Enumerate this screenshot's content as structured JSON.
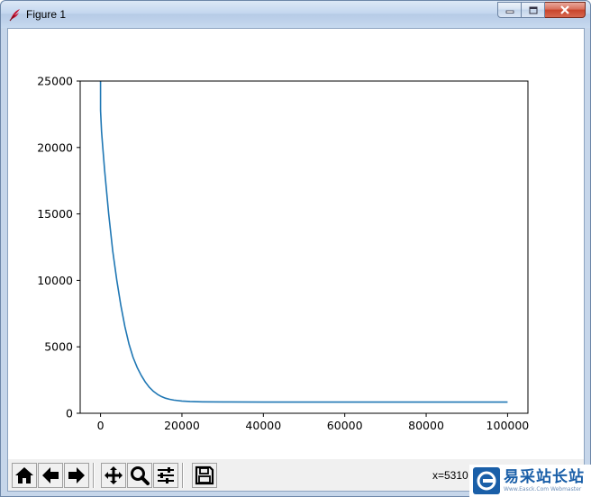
{
  "window": {
    "title": "Figure 1",
    "icon": "tk-feather-icon"
  },
  "caption_buttons": {
    "minimize": "minimize-icon",
    "maximize": "maximize-icon",
    "close": "close-icon"
  },
  "chart_data": {
    "type": "line",
    "title": "",
    "xlabel": "",
    "ylabel": "",
    "xlim": [
      -5000,
      105000
    ],
    "ylim": [
      0,
      25000
    ],
    "x_ticks": [
      0,
      20000,
      40000,
      60000,
      80000,
      100000
    ],
    "x_tick_labels": [
      "0",
      "20000",
      "40000",
      "60000",
      "80000",
      "100000"
    ],
    "y_ticks": [
      0,
      5000,
      10000,
      15000,
      20000,
      25000
    ],
    "y_tick_labels": [
      "0",
      "5000",
      "10000",
      "15000",
      "20000",
      "25000"
    ],
    "grid": false,
    "series_color": "#1f77b4",
    "series": [
      {
        "x": [
          0,
          0,
          250,
          500,
          1000,
          2000,
          3000,
          4000,
          5000,
          6000,
          7000,
          8000,
          9000,
          10000,
          11000,
          12000,
          13000,
          14000,
          15000,
          16000,
          17000,
          18000,
          20000,
          22000,
          25000,
          30000,
          40000,
          50000,
          60000,
          70000,
          80000,
          90000,
          100000
        ],
        "y": [
          25000,
          22800,
          21200,
          20200,
          18300,
          15000,
          12200,
          10000,
          8100,
          6500,
          5200,
          4200,
          3450,
          2850,
          2350,
          1950,
          1650,
          1420,
          1250,
          1130,
          1050,
          990,
          920,
          885,
          860,
          850,
          845,
          843,
          842,
          842,
          841,
          841,
          841
        ]
      }
    ]
  },
  "toolbar": {
    "buttons": [
      {
        "name": "home-button",
        "icon": "home-icon"
      },
      {
        "name": "back-button",
        "icon": "back-arrow-icon"
      },
      {
        "name": "forward-button",
        "icon": "forward-arrow-icon"
      },
      {
        "name": "pan-button",
        "icon": "pan-move-icon"
      },
      {
        "name": "zoom-button",
        "icon": "zoom-magnifier-icon"
      },
      {
        "name": "subplots-button",
        "icon": "configure-subplots-icon"
      },
      {
        "name": "save-button",
        "icon": "floppy-disk-icon"
      }
    ],
    "coordinate_readout": "x=5310"
  },
  "watermark": {
    "text_cn": "易采站长站",
    "text_en": "Www.Easck.Com Webmaster",
    "color": "#1a5fa8"
  }
}
